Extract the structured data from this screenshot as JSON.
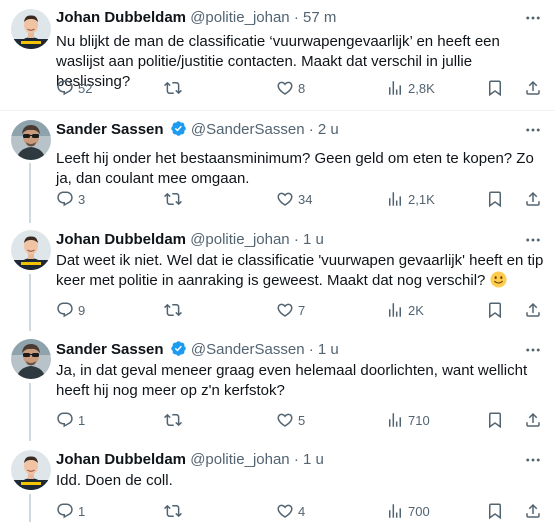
{
  "tweets": [
    {
      "name": "Johan Dubbeldam",
      "handle": "@politie_johan",
      "time": "· 57 m",
      "verified": false,
      "text": "Nu blijkt de man de classificatie ‘vuurwapengevaarlijk’ en heeft een waslijst aan politie/justitie contacten. Maakt dat verschil in jullie beslissing?",
      "replies": "52",
      "retweets": "",
      "likes": "8",
      "views": "2,8K"
    },
    {
      "name": "Sander Sassen",
      "handle": "@SanderSassen",
      "time": "· 2 u",
      "verified": true,
      "text": "Leeft hij onder het bestaansminimum? Geen geld om eten te kopen? Zo ja, dan coulant mee omgaan.",
      "replies": "3",
      "retweets": "",
      "likes": "34",
      "views": "2,1K"
    },
    {
      "name": "Johan Dubbeldam",
      "handle": "@politie_johan",
      "time": "· 1 u",
      "verified": false,
      "text": "Dat weet ik niet. Wel dat ie classificatie 'vuurwapen gevaarlijk' heeft en tip keer met politie in aanraking is geweest. Maakt dat nog verschil?",
      "replies": "9",
      "retweets": "",
      "likes": "7",
      "views": "2K"
    },
    {
      "name": "Sander Sassen",
      "handle": "@SanderSassen",
      "time": "· 1 u",
      "verified": true,
      "text": "Ja, in dat geval meneer graag even helemaal doorlichten, want wellicht heeft hij nog meer op z'n kerfstok?",
      "replies": "1",
      "retweets": "",
      "likes": "5",
      "views": "710"
    },
    {
      "name": "Johan Dubbeldam",
      "handle": "@politie_johan",
      "time": "· 1 u",
      "verified": false,
      "text": "Idd. Doen de coll.",
      "replies": "1",
      "retweets": "",
      "likes": "4",
      "views": "700"
    }
  ],
  "colors": {
    "text": "#0f1419",
    "secondary": "#536471",
    "verified": "#1d9bf0",
    "divider": "#eff3f4",
    "thread_line": "#cfd9de"
  },
  "icons": {
    "reply": "speech-bubble-icon",
    "retweet": "retweet-arrows-icon",
    "like": "heart-outline-icon",
    "views": "bar-chart-icon",
    "bookmark": "bookmark-icon",
    "share": "share-upload-icon",
    "more": "more-dots-icon",
    "verified": "verified-badge-icon",
    "emoji": "slightly-smiling-face-emoji"
  }
}
